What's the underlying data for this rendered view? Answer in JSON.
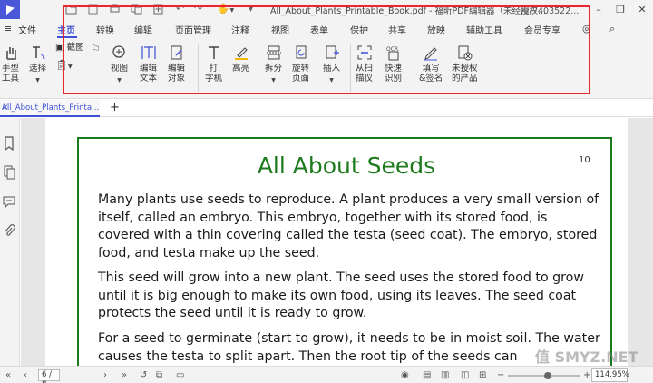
{
  "titlebar": {
    "doc_title": "All_About_Plants_Printable_Book.pdf - 福昕PDF编辑器（未经授权...",
    "user": "用户403522...",
    "minimize": "–",
    "restore": "❐",
    "close": "✕"
  },
  "menu": {
    "tabs": [
      "文件",
      "主页",
      "转换",
      "编辑",
      "页面管理",
      "注释",
      "视图",
      "表单",
      "保护",
      "共享",
      "放映",
      "辅助工具",
      "会员专享"
    ],
    "active": "主页"
  },
  "ribbon": {
    "hand": "手型\n工具",
    "select": "选择",
    "screenshot": "截图",
    "view": "视图",
    "edit_text": "编辑\n文本",
    "edit_object": "编辑\n对象",
    "typewriter": "打\n字机",
    "highlight": "高亮",
    "split": "拆分",
    "rotate": "旋转\n页面",
    "insert": "插入",
    "scan": "从扫\n描仪",
    "ocr": "快速\n识别",
    "fill_sign": "填写\n&签名",
    "unlicensed": "未授权\n的产品"
  },
  "tabs": {
    "doc_tab": "All_About_Plants_Printa...",
    "add": "+"
  },
  "page": {
    "heading": "All About Seeds",
    "page_number": "10",
    "paragraphs": [
      "Many plants use seeds to reproduce. A plant produces a very small version of itself, called an embryo. This embryo, together with its stored food, is covered with a thin covering called the testa (seed coat). The embryo, stored food, and testa make up the seed.",
      "This seed will grow into a new plant. The seed uses the stored food to grow until it is big enough to make its own food, using its leaves. The seed coat protects the seed until it is ready to grow.",
      "For a seed to germinate (start to grow), it needs to be in moist soil. The water causes the testa to split apart. Then the root tip of the seeds can"
    ]
  },
  "statusbar": {
    "page_indicator": "6 / 8",
    "zoom": "114.95%",
    "zoom_level": 0.55
  },
  "watermark": "值 SMYZ.NET",
  "colors": {
    "accent": "#3d4fd6",
    "highlight_box": "#e8262d",
    "heading_green": "#1d7a1d"
  }
}
